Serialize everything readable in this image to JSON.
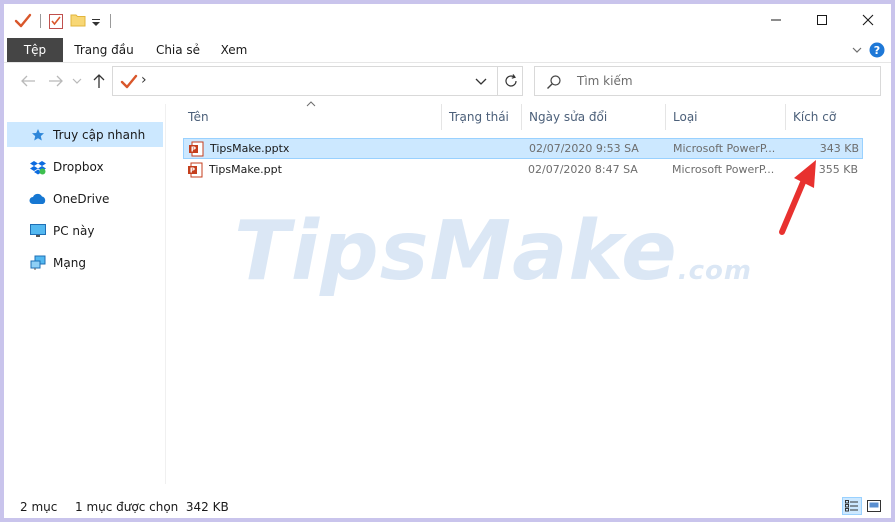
{
  "ribbon": {
    "tabs": [
      "Tệp",
      "Trang đầu",
      "Chia sẻ",
      "Xem"
    ]
  },
  "address": {
    "crumb": "›",
    "icon": "checkmark-icon"
  },
  "search": {
    "placeholder": "Tìm kiếm"
  },
  "nav": {
    "items": [
      {
        "label": "Truy cập nhanh",
        "icon": "star-icon",
        "selected": true
      },
      {
        "label": "Dropbox",
        "icon": "dropbox-icon"
      },
      {
        "label": "OneDrive",
        "icon": "cloud-icon"
      },
      {
        "label": "PC này",
        "icon": "monitor-icon"
      },
      {
        "label": "Mạng",
        "icon": "network-icon"
      }
    ]
  },
  "columns": {
    "name": "Tên",
    "status": "Trạng thái",
    "date": "Ngày sửa đổi",
    "type": "Loại",
    "size": "Kích cỡ"
  },
  "files": [
    {
      "name": "TipsMake.pptx",
      "date": "02/07/2020 9:53 SA",
      "type": "Microsoft PowerP...",
      "size": "343 KB",
      "selected": true
    },
    {
      "name": "TipsMake.ppt",
      "date": "02/07/2020 8:47 SA",
      "type": "Microsoft PowerP...",
      "size": "355 KB",
      "selected": false
    }
  ],
  "watermark": {
    "main": "TipsMake",
    "suffix": ".com"
  },
  "status": {
    "count": "2 mục",
    "selection": "1 mục được chọn  342 KB"
  },
  "colors": {
    "accent": "#cce8ff",
    "file_tab": "#454545",
    "annotation_arrow": "#e8312f"
  }
}
